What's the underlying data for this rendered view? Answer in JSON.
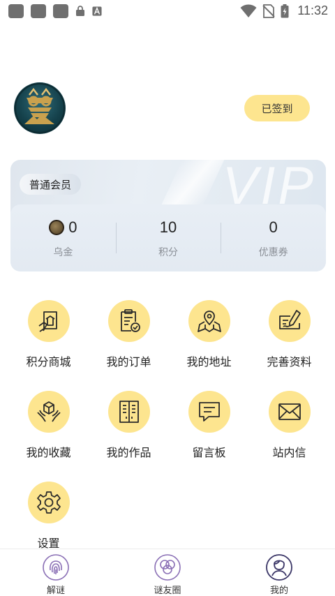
{
  "status_bar": {
    "time": "11:32",
    "left_icons": [
      "app-icon",
      "app-icon",
      "app-icon",
      "lock-icon",
      "a-icon"
    ],
    "right_icons": [
      "wifi-icon",
      "no-sim-icon",
      "battery-charging-icon"
    ]
  },
  "profile": {
    "avatar_icon": "avatar-logo",
    "checkin_label": "已签到"
  },
  "vip_card": {
    "watermark": "VIP",
    "member_level": "普通会员",
    "stats": [
      {
        "value": "0",
        "label": "乌金",
        "icon": "coin-icon"
      },
      {
        "value": "10",
        "label": "积分"
      },
      {
        "value": "0",
        "label": "优惠券"
      }
    ]
  },
  "menu": {
    "items": [
      {
        "label": "积分商城",
        "icon": "points-mall-icon"
      },
      {
        "label": "我的订单",
        "icon": "orders-icon"
      },
      {
        "label": "我的地址",
        "icon": "address-icon"
      },
      {
        "label": "完善资料",
        "icon": "edit-profile-icon"
      },
      {
        "label": "我的收藏",
        "icon": "favorites-icon"
      },
      {
        "label": "我的作品",
        "icon": "works-icon"
      },
      {
        "label": "留言板",
        "icon": "message-board-icon"
      },
      {
        "label": "站内信",
        "icon": "mail-icon"
      },
      {
        "label": "设置",
        "icon": "settings-icon"
      }
    ]
  },
  "bottom_nav": {
    "items": [
      {
        "label": "解谜",
        "icon": "fingerprint-icon"
      },
      {
        "label": "谜友圈",
        "icon": "circles-icon"
      },
      {
        "label": "我的",
        "icon": "profile-icon",
        "active": true
      }
    ]
  },
  "colors": {
    "accent_yellow": "#fde58f",
    "icon_stroke": "#2a2a2a",
    "nav_purple": "#8a6fb5"
  }
}
